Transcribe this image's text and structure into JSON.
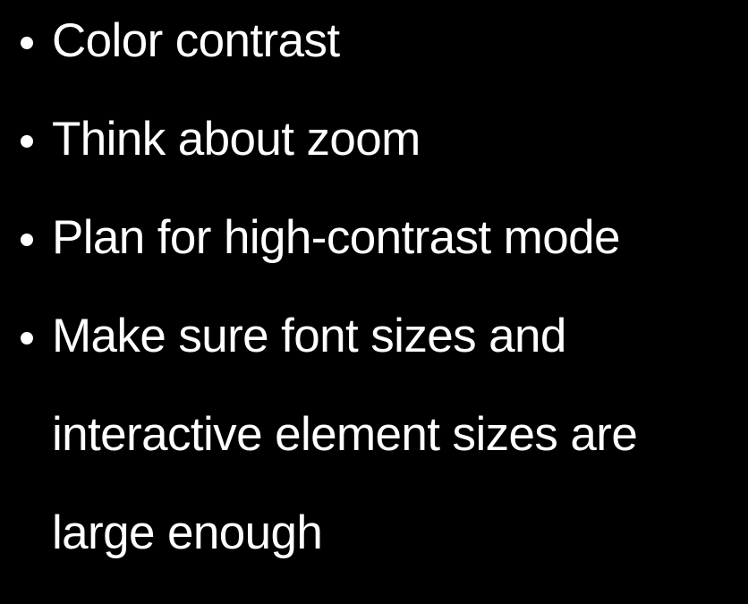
{
  "colors": {
    "background": "#000000",
    "text": "#ffffff"
  },
  "bullets": [
    {
      "text": "Color contrast"
    },
    {
      "text": "Think about zoom"
    },
    {
      "text": "Plan for high-contrast mode"
    },
    {
      "text": "Make sure font sizes and interactive element sizes are large enough"
    }
  ]
}
